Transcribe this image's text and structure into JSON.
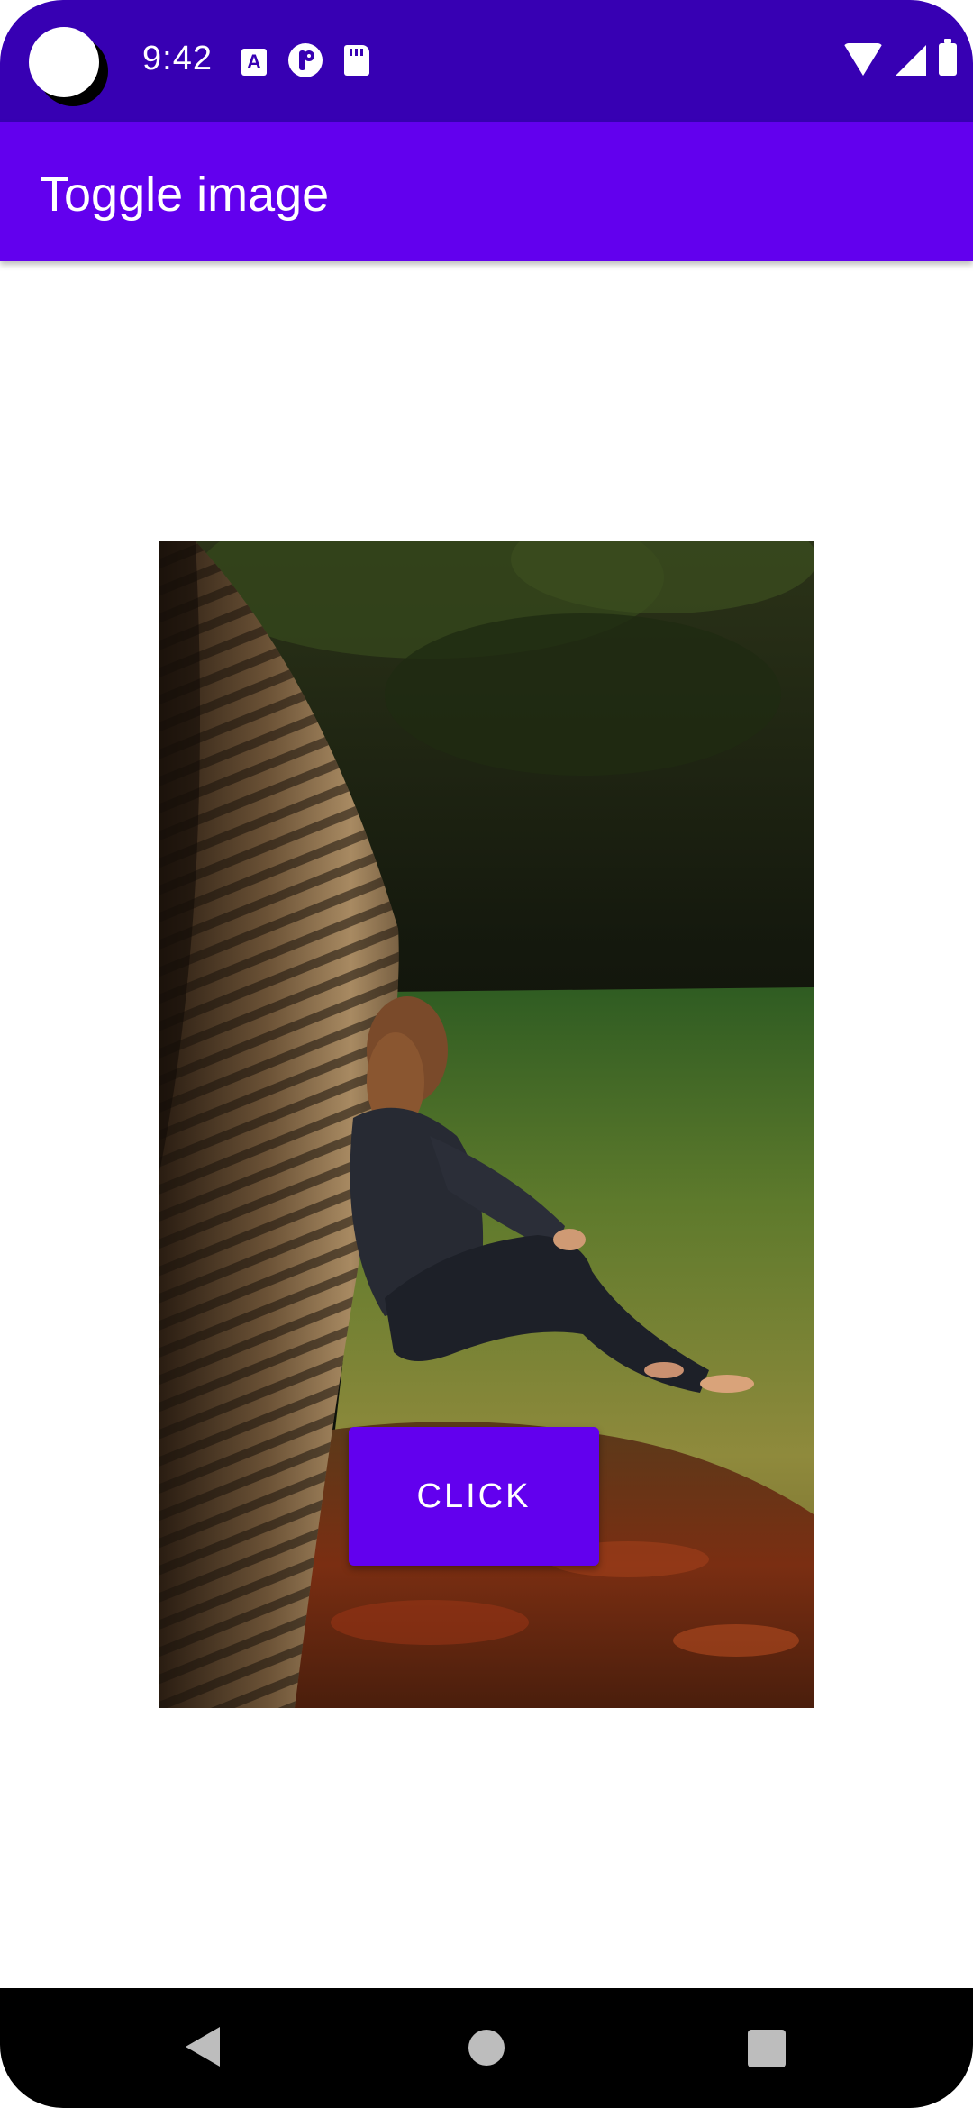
{
  "status_bar": {
    "time": "9:42",
    "icons": [
      "app-notification-icon",
      "pocket-icon",
      "sd-card-icon",
      "wifi-icon",
      "cell-signal-icon",
      "battery-icon"
    ],
    "color": "#3700b3"
  },
  "app_bar": {
    "title": "Toggle image",
    "color": "#6200ee"
  },
  "main": {
    "image_subject": "photo",
    "button_label": "CLICK",
    "button_color": "#6200ee"
  },
  "nav_bar": {
    "icons": [
      "back-icon",
      "home-icon",
      "recents-icon"
    ]
  }
}
